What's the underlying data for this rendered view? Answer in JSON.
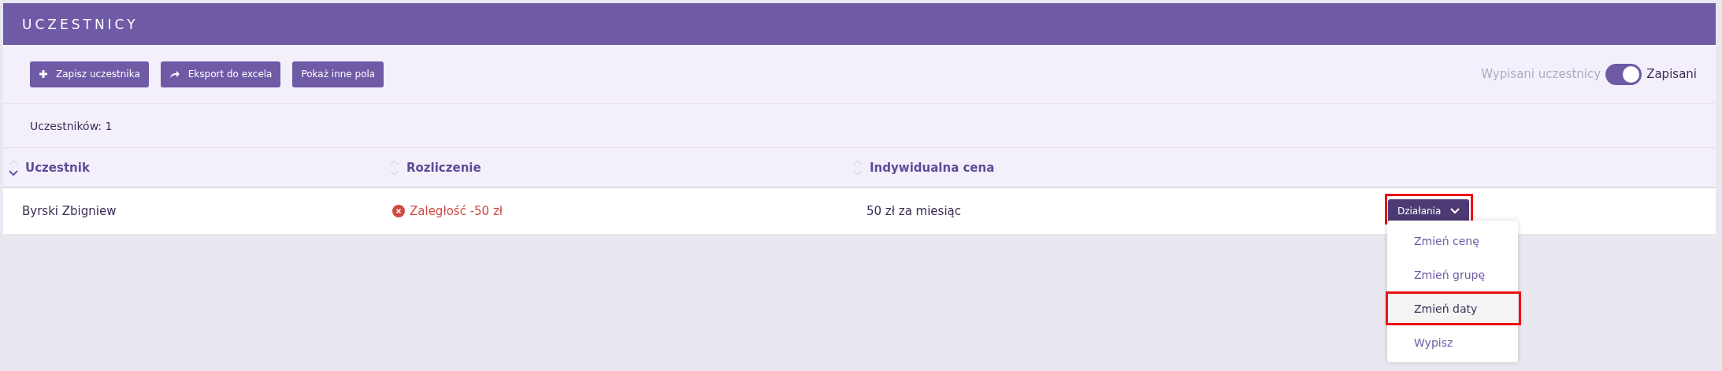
{
  "panel": {
    "title": "UCZESTNICY"
  },
  "toolbar": {
    "buttons": [
      {
        "label": "Zapisz uczestnika",
        "kind": "add"
      },
      {
        "label": "Eksport do excela",
        "kind": "export"
      },
      {
        "label": "Pokaż inne pola",
        "kind": "plain"
      }
    ],
    "toggle": {
      "off_label": "Wypisani uczestnicy",
      "on_label": "Zapisani",
      "on": true
    }
  },
  "count": "Uczestników: 1",
  "table": {
    "columns": [
      {
        "label": "Uczestnik",
        "sorted": true
      },
      {
        "label": "Rozliczenie",
        "sorted": false
      },
      {
        "label": "Indywidualna cena",
        "sorted": false
      }
    ],
    "rows": [
      {
        "name": "Byrski Zbigniew",
        "balance": "Zaległość -50 zł",
        "overdue": true,
        "price": "50 zł za miesiąc",
        "actions": {
          "label": "Działania",
          "highlighted": true,
          "expanded": true,
          "menu": [
            {
              "label": "Zmień cenę",
              "selected": false,
              "highlighted": false
            },
            {
              "label": "Zmień grupę",
              "selected": false,
              "highlighted": false
            },
            {
              "label": "Zmień daty",
              "selected": true,
              "highlighted": true
            },
            {
              "label": "Wypisz",
              "selected": false,
              "highlighted": false
            }
          ]
        }
      }
    ]
  }
}
